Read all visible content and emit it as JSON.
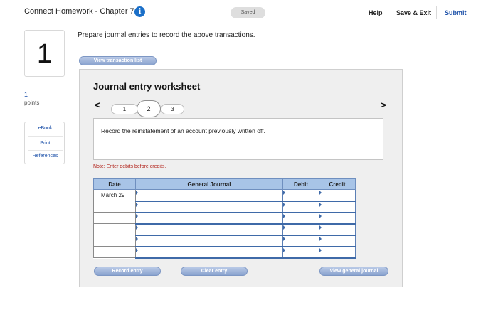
{
  "header": {
    "title": "Connect Homework - Chapter 7",
    "info_icon": "info-icon",
    "saved": "Saved",
    "help": "Help",
    "save_exit": "Save & Exit",
    "submit": "Submit"
  },
  "question": {
    "number": "1",
    "points_value": "1",
    "points_label": "points",
    "prompt": "Prepare journal entries to record the above transactions.",
    "view_transaction_list": "View transaction list"
  },
  "tools": {
    "ebook": "eBook",
    "print": "Print",
    "references": "References"
  },
  "worksheet": {
    "title": "Journal entry worksheet",
    "prev_arrow": "<",
    "next_arrow": ">",
    "steps": [
      "1",
      "2",
      "3"
    ],
    "active_step": "2",
    "description": "Record the reinstatement of an account previously written off.",
    "note": "Note: Enter debits before credits.",
    "table": {
      "headers": [
        "Date",
        "General Journal",
        "Debit",
        "Credit"
      ],
      "rows": [
        {
          "date": "March 29",
          "general_journal": "",
          "debit": "",
          "credit": ""
        },
        {
          "date": "",
          "general_journal": "",
          "debit": "",
          "credit": ""
        },
        {
          "date": "",
          "general_journal": "",
          "debit": "",
          "credit": ""
        },
        {
          "date": "",
          "general_journal": "",
          "debit": "",
          "credit": ""
        },
        {
          "date": "",
          "general_journal": "",
          "debit": "",
          "credit": ""
        },
        {
          "date": "",
          "general_journal": "",
          "debit": "",
          "credit": ""
        }
      ]
    },
    "buttons": {
      "record_entry": "Record entry",
      "clear_entry": "Clear entry",
      "view_general_journal": "View general journal"
    }
  },
  "colors": {
    "accent": "#1a4fa8",
    "info_icon": "#1a6fc8",
    "header_cell": "#a8c4e7",
    "note_red": "#b3261e"
  }
}
